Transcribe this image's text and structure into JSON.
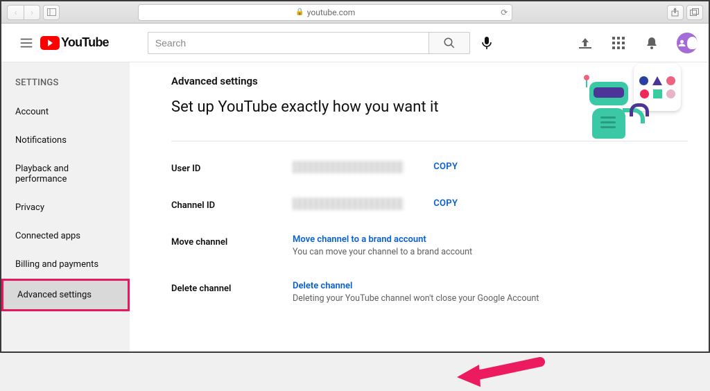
{
  "browser": {
    "url": "youtube.com"
  },
  "header": {
    "logo_text": "YouTube",
    "search_placeholder": "Search"
  },
  "sidebar": {
    "title": "SETTINGS",
    "items": [
      {
        "label": "Account"
      },
      {
        "label": "Notifications"
      },
      {
        "label": "Playback and performance"
      },
      {
        "label": "Privacy"
      },
      {
        "label": "Connected apps"
      },
      {
        "label": "Billing and payments"
      },
      {
        "label": "Advanced settings"
      }
    ],
    "active_index": 6
  },
  "main": {
    "page_title": "Advanced settings",
    "subtitle": "Set up YouTube exactly how you want it",
    "user_id": {
      "label": "User ID",
      "copy": "COPY"
    },
    "channel_id": {
      "label": "Channel ID",
      "copy": "COPY"
    },
    "move_channel": {
      "label": "Move channel",
      "link": "Move channel to a brand account",
      "sub": "You can move your channel to a brand account"
    },
    "delete_channel": {
      "label": "Delete channel",
      "link": "Delete channel",
      "sub": "Deleting your YouTube channel won't close your Google Account"
    }
  },
  "colors": {
    "link": "#065fd4",
    "highlight": "#e6195c",
    "youtube_red": "#ff0000"
  }
}
